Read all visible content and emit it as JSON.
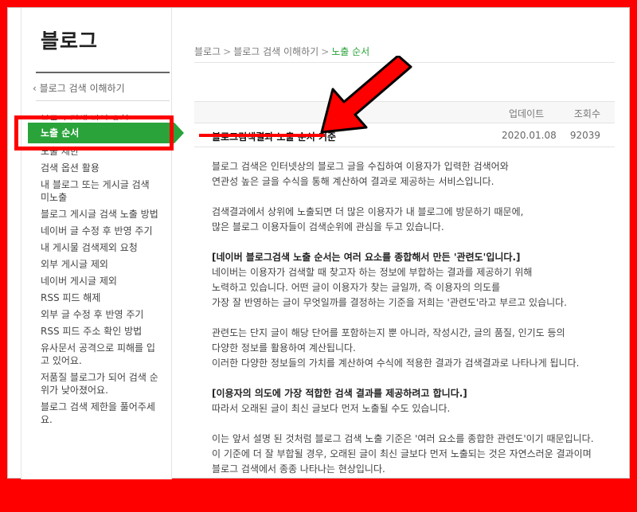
{
  "sidebar": {
    "title": "블로그",
    "back_link": "블로그 검색 이해하기",
    "items": [
      "블로그 검색 반영 요청",
      "노출 순서",
      "노출 제한",
      "검색 옵션 활용",
      "내 블로그 또는 게시글 검색\n미노출",
      "블로그 게시글 검색 노출 방법",
      "네이버 글 수정 후 반영 주기",
      "내 게시물 검색제외 요청",
      "외부 게시글 제외",
      "네이버 게시글 제외",
      "RSS 피드 해제",
      "외부 글 수정 후 반영 주기",
      "RSS 피드 주소 확인 방법",
      "유사문서 공격으로 피해를 입\n고 있어요.",
      "저품질 블로그가 되어 검색 순\n위가 낮아졌어요.",
      "블로그 검색 제한을 풀어주세\n요."
    ]
  },
  "breadcrumb": {
    "items": [
      "블로그",
      "블로그 검색 이해하기",
      "노출 순서"
    ],
    "separator": ">"
  },
  "table": {
    "headers": {
      "updated": "업데이트",
      "views": "조회수"
    },
    "row": {
      "title": "블로그검색결과 노출 순서 기준",
      "date": "2020.01.08",
      "views": "92039"
    }
  },
  "article": {
    "p1": [
      "블로그 검색은 인터넷상의 블로그 글을 수집하여 이용자가 입력한 검색어와",
      "연관성 높은 글을 수식을 통해 계산하여 결과로 제공하는 서비스입니다."
    ],
    "p2": [
      "검색결과에서 상위에 노출되면 더 많은 이용자가 내 블로그에 방문하기 때문에,",
      "많은 블로그 이용자들이 검색순위에 관심을 두고 있습니다."
    ],
    "h1": "[네이버 블로그검색 노출 순서는 여러 요소를 종합해서 만든 '관련도'입니다.]",
    "p3": [
      "네이버는 이용자가 검색할 때 찾고자 하는 정보에 부합하는 결과를 제공하기 위해",
      "노력하고 있습니다. 어떤 글이 이용자가 찾는 글일까, 즉 이용자의 의도를",
      "가장 잘 반영하는 글이 무엇일까를 결정하는 기준을 저희는 '관련도'라고 부르고 있습니다."
    ],
    "p4": [
      "관련도는 단지 글이 해당 단어를 포함하는지 뿐 아니라, 작성시간, 글의 품질, 인기도 등의",
      "다양한 정보를 활용하여 계산됩니다.",
      "이러한 다양한 정보들의 가치를 계산하여 수식에 적용한 결과가 검색결과로 나타나게 됩니다."
    ],
    "h2": "[이용자의 의도에 가장 적합한 검색 결과를 제공하려고 합니다.]",
    "p5": [
      "따라서 오래된 글이 최신 글보다 먼저 노출될 수도 있습니다."
    ],
    "p6": [
      "이는 앞서 설명 된 것처럼 블로그 검색 노출 기준은 '여러 요소를 종합한 관련도'이기 때문입니다.",
      "이 기준에 더 잘 부합될 경우, 오래된 글이 최신 글보다 먼저 노출되는 것은 자연스러운 결과이며",
      "블로그 검색에서 종종 나타나는 현상입니다."
    ]
  },
  "colors": {
    "accent_green": "#2aa33a",
    "annotation_red": "#ff0000"
  }
}
